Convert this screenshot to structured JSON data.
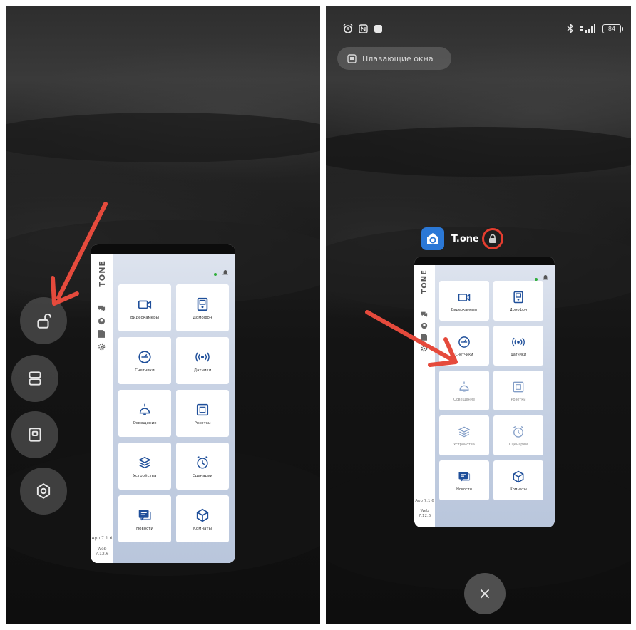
{
  "colors": {
    "arrow": "#e54a3c",
    "tile_icon": "#1f4f9a",
    "accent_green": "#2fae3a",
    "app_icon_bg": "#2b78d6"
  },
  "left_panel": {
    "side_buttons": [
      {
        "name": "unlock-icon"
      },
      {
        "name": "split-screen-icon"
      },
      {
        "name": "floating-window-icon"
      },
      {
        "name": "settings-hexagon-icon"
      }
    ],
    "app_preview": {
      "logo": "TONE",
      "version_app": "App 7.1.6",
      "version_web": "Web 7.12.6"
    }
  },
  "right_panel": {
    "status_bar": {
      "battery": "84"
    },
    "floating_windows_label": "Плавающие окна",
    "app_name": "T.one",
    "app_preview": {
      "logo": "TONE",
      "version_app": "App 7.1.6",
      "version_web": "Web 7.12.6"
    },
    "close_label": "×"
  },
  "tiles": [
    {
      "label": "Видеокамеры",
      "icon": "video-camera-icon"
    },
    {
      "label": "Домофон",
      "icon": "intercom-icon"
    },
    {
      "label": "Счетчики",
      "icon": "meter-icon"
    },
    {
      "label": "Датчики",
      "icon": "sensor-icon"
    },
    {
      "label": "Освещение",
      "icon": "lamp-icon"
    },
    {
      "label": "Розетки",
      "icon": "socket-icon"
    },
    {
      "label": "Устройства",
      "icon": "devices-icon"
    },
    {
      "label": "Сценарии",
      "icon": "scenario-icon"
    },
    {
      "label": "Новости",
      "icon": "news-icon"
    },
    {
      "label": "Комнаты",
      "icon": "rooms-icon"
    }
  ]
}
